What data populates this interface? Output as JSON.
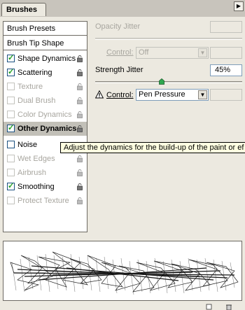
{
  "panel": {
    "tab_label": "Brushes",
    "menu_icon": "flyout-menu-icon"
  },
  "leftlist": {
    "items": [
      {
        "label": "Brush Presets"
      },
      {
        "label": "Brush Tip Shape"
      },
      {
        "label": "Shape Dynamics",
        "checked": true,
        "lock": true
      },
      {
        "label": "Scattering",
        "checked": true,
        "lock": true
      },
      {
        "label": "Texture",
        "checked": false,
        "lock": true
      },
      {
        "label": "Dual Brush",
        "checked": false,
        "lock": true
      },
      {
        "label": "Color Dynamics",
        "checked": false,
        "lock": true
      },
      {
        "label": "Other Dynamics",
        "checked": true,
        "lock": true,
        "selected": true
      },
      {
        "label": "Noise",
        "checked": false,
        "lock": false
      },
      {
        "label": "Wet Edges",
        "checked": false,
        "lock": true
      },
      {
        "label": "Airbrush",
        "checked": false,
        "lock": true
      },
      {
        "label": "Smoothing",
        "checked": true,
        "lock": true
      },
      {
        "label": "Protect Texture",
        "checked": false,
        "lock": true
      }
    ]
  },
  "opacity": {
    "jitter_label": "Opacity Jitter",
    "jitter_value": "",
    "control_label": "Control:",
    "control_value": "Off",
    "control_field_value": ""
  },
  "strength": {
    "jitter_label": "Strength Jitter",
    "jitter_value": "45%",
    "jitter_fraction": 0.45,
    "control_label": "Control:",
    "control_value": "Pen Pressure",
    "control_field_value": ""
  },
  "tooltip": {
    "text": "Adjust the dynamics for the build-up of the paint or ef"
  },
  "colors": {
    "panel_bg": "#ece9e0",
    "check_green": "#21a121",
    "tooltip_bg": "#ffffe1"
  }
}
